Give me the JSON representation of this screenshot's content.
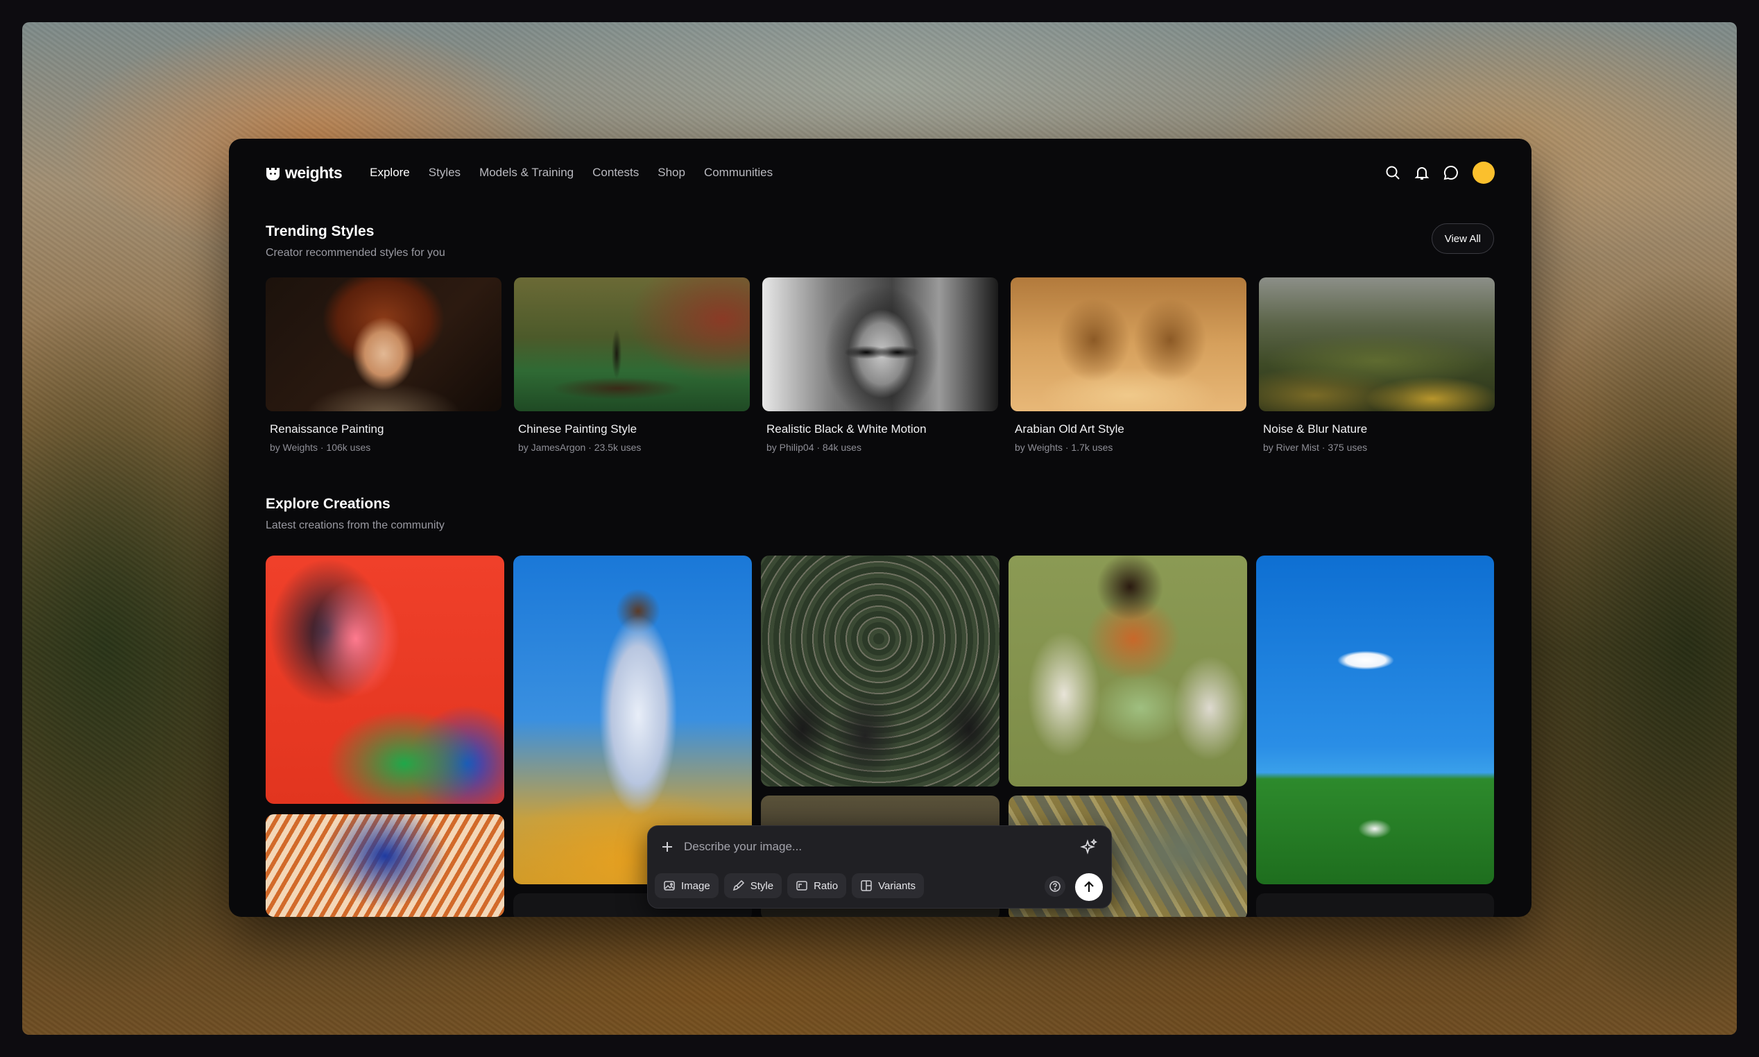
{
  "brand": {
    "name": "weights"
  },
  "nav": {
    "links": [
      {
        "label": "Explore",
        "active": true
      },
      {
        "label": "Styles"
      },
      {
        "label": "Models & Training"
      },
      {
        "label": "Contests"
      },
      {
        "label": "Shop"
      },
      {
        "label": "Communities"
      }
    ],
    "icons": [
      "search-icon",
      "bell-icon",
      "chat-icon"
    ],
    "avatar_color": "#fbc02d"
  },
  "trending": {
    "title": "Trending Styles",
    "subtitle": "Creator recommended styles for you",
    "view_all": "View All",
    "items": [
      {
        "name": "Renaissance Painting",
        "meta": "by Weights · 106k uses"
      },
      {
        "name": "Chinese Painting Style",
        "meta": "by JamesArgon · 23.5k uses"
      },
      {
        "name": "Realistic Black & White Motion",
        "meta": "by Philip04 · 84k uses"
      },
      {
        "name": "Arabian Old Art Style",
        "meta": "by Weights · 1.7k uses"
      },
      {
        "name": "Noise & Blur Nature",
        "meta": "by River Mist · 375 uses"
      }
    ]
  },
  "explore": {
    "title": "Explore Creations",
    "subtitle": "Latest creations from the community"
  },
  "prompt": {
    "placeholder": "Describe your image...",
    "chips": [
      {
        "label": "Image",
        "icon": "image-icon"
      },
      {
        "label": "Style",
        "icon": "brush-icon"
      },
      {
        "label": "Ratio",
        "icon": "ratio-icon"
      },
      {
        "label": "Variants",
        "icon": "variants-icon"
      }
    ]
  }
}
